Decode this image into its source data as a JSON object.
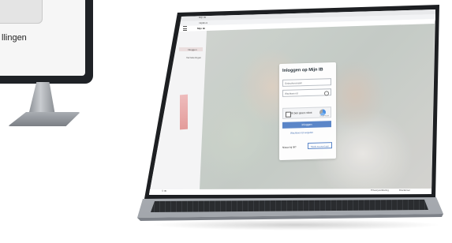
{
  "monitor": {
    "visible_text": "llingen"
  },
  "browser": {
    "tab_title": "· Mijn IB",
    "url": "mijnib.nl",
    "app_name": "Mijn IB"
  },
  "sidebar": {
    "items": [
      {
        "label": "Inloggen"
      },
      {
        "label": "Verzekeringen"
      }
    ]
  },
  "login": {
    "title": "Inloggen op Mijn IB",
    "username_placeholder": "Gebruikersnaam",
    "password_placeholder": "Wachtwoord",
    "captcha_label": "Ik ben geen robot",
    "captcha_brand": "reCAPTCHA",
    "login_button": "Inloggen",
    "forgot_link": "Wachtwoord vergeten",
    "new_user_text": "Nieuw bij IB?",
    "new_account_button": "Maak account aan"
  },
  "footer": {
    "left": "© IB",
    "right_1": "Privacyverklaring",
    "right_2": "Disclaimer"
  },
  "colors": {
    "accent": "#5b86c8",
    "brand_red": "#d6534f"
  }
}
